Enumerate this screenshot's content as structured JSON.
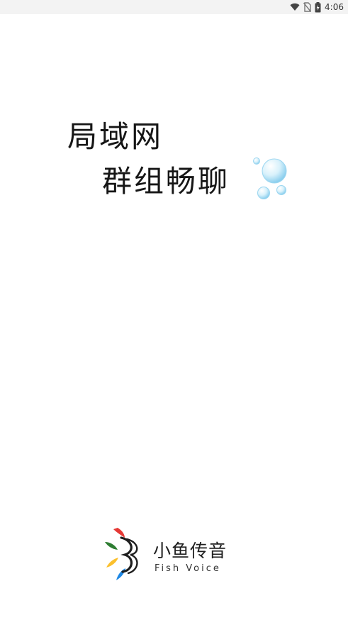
{
  "status_bar": {
    "time": "4:06",
    "icons": [
      "wifi-icon",
      "no-sim-icon",
      "battery-charging-icon"
    ]
  },
  "splash": {
    "slogan_line1": "局域网",
    "slogan_line2": "群组畅聊",
    "decoration": "bubbles-icon"
  },
  "brand": {
    "name": "小鱼传音",
    "subtitle": "Fish Voice",
    "logo": "fish-logo-icon",
    "colors": [
      "#e53935",
      "#2e7d32",
      "#fbc02d",
      "#1e88e5"
    ]
  }
}
